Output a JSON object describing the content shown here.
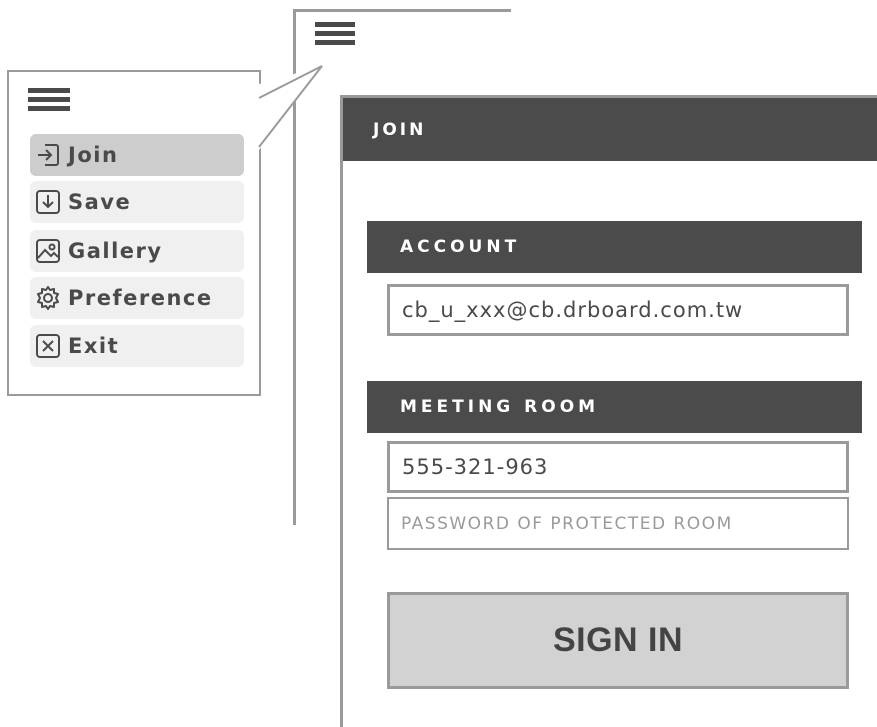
{
  "menu": {
    "items": [
      {
        "label": "Join",
        "icon": "enter-icon",
        "active": true
      },
      {
        "label": "Save",
        "icon": "download-icon",
        "active": false
      },
      {
        "label": "Gallery",
        "icon": "image-icon",
        "active": false
      },
      {
        "label": "Preference",
        "icon": "gear-icon",
        "active": false
      },
      {
        "label": "Exit",
        "icon": "close-box-icon",
        "active": false
      }
    ]
  },
  "panel": {
    "title": "JOIN",
    "account": {
      "heading": "ACCOUNT",
      "value": "cb_u_xxx@cb.drboard.com.tw"
    },
    "meeting_room": {
      "heading": "MEETING ROOM",
      "room_value": "555-321-963",
      "password_placeholder": "PASSWORD OF PROTECTED ROOM"
    },
    "sign_in_label": "SIGN IN"
  },
  "colors": {
    "header_bg": "#4b4b4b",
    "border": "#9a9a9a",
    "active_item": "#cdcdcd",
    "item_bg": "#f0f0f0",
    "button_bg": "#d2d2d2"
  }
}
